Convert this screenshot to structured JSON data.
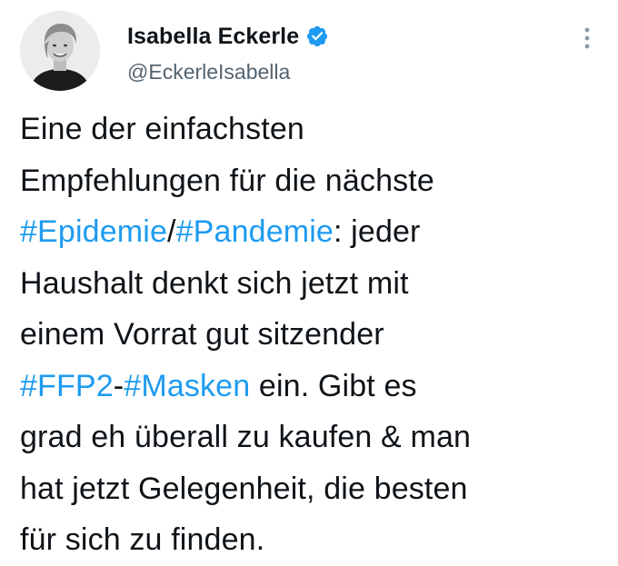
{
  "author": {
    "display_name": "Isabella Eckerle",
    "handle": "@EckerleIsabella",
    "verified": true
  },
  "colors": {
    "hashtag": "#1d9bf0",
    "verified_badge": "#1d9bf0",
    "text": "#0f1419",
    "secondary_text": "#536471"
  },
  "icons": {
    "verified": "verified-badge-icon",
    "more": "more-options-icon"
  },
  "tweet": {
    "line1": "Eine der einfachsten",
    "line2": "Empfehlungen für die nächste",
    "line3_tag1": "#Epidemie",
    "line3_sep": "/",
    "line3_tag2": "#Pandemie",
    "line3_rest": ": jeder",
    "line4": "Haushalt denkt sich jetzt mit",
    "line5": "einem Vorrat gut sitzender",
    "line6_tag1": "#FFP2",
    "line6_sep": "-",
    "line6_tag2": "#Masken",
    "line6_rest": " ein. Gibt es",
    "line7": "grad eh überall zu kaufen & man",
    "line8": "hat jetzt Gelegenheit, die besten",
    "line9": "für sich zu finden."
  }
}
